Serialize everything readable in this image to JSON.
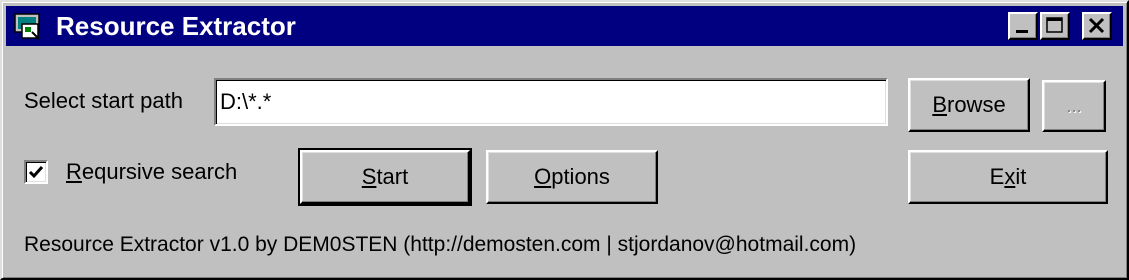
{
  "window": {
    "title": "Resource Extractor",
    "icon": "app-icon"
  },
  "caption_buttons": {
    "minimize": "minimize-icon",
    "maximize": "maximize-icon",
    "close": "close-icon"
  },
  "path": {
    "label": "Select start path",
    "value": "D:\\*.*"
  },
  "buttons": {
    "browse_label": "rowse",
    "browse_mnemonic": "B",
    "ellipsis_label": "...",
    "start_label": "tart",
    "start_mnemonic": "S",
    "options_label": "ptions",
    "options_mnemonic": "O",
    "exit_label_pre": "E",
    "exit_mnemonic": "x",
    "exit_label_post": "it"
  },
  "recursive": {
    "label_mnemonic": "R",
    "label_rest": "eqursive search",
    "checked": true
  },
  "footer": {
    "text": "Resource Extractor v1.0 by DEM0STEN (http://demosten.com | stjordanov@hotmail.com)"
  }
}
